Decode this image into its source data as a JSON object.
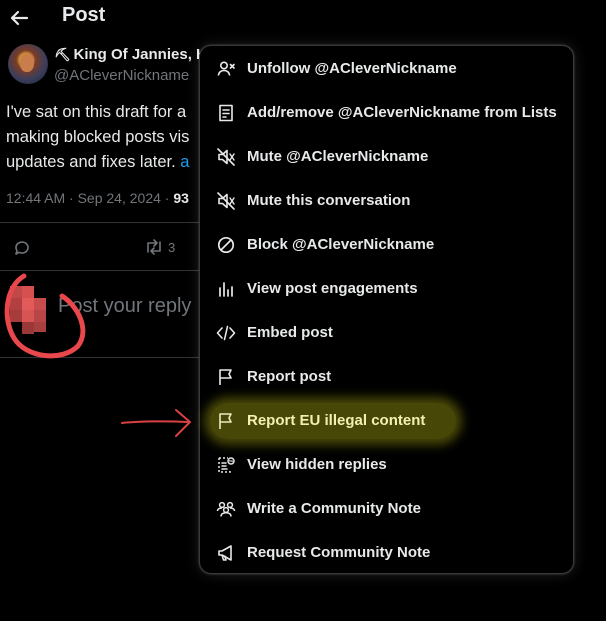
{
  "header": {
    "title": "Post",
    "back_icon": "arrow-left-icon"
  },
  "post": {
    "author_name": "King Of Jannies, H",
    "author_handle": "@ACleverNickname",
    "text_lines": [
      "I've sat on this draft for a",
      "making blocked posts vis",
      "updates and fixes later. "
    ],
    "text_link": "a",
    "timestamp": "12:44 AM · Sep 24, 2024 · ",
    "views": "93",
    "repost_count": "3"
  },
  "reply_box": {
    "placeholder": "Post your reply"
  },
  "menu": {
    "items": [
      {
        "label": "Unfollow @ACleverNickname",
        "icon": "unfollow-icon"
      },
      {
        "label": "Add/remove @ACleverNickname from Lists",
        "icon": "list-icon"
      },
      {
        "label": "Mute @ACleverNickname",
        "icon": "mute-icon"
      },
      {
        "label": "Mute this conversation",
        "icon": "mute-conversation-icon"
      },
      {
        "label": "Block @ACleverNickname",
        "icon": "block-icon"
      },
      {
        "label": "View post engagements",
        "icon": "engagements-icon"
      },
      {
        "label": "Embed post",
        "icon": "embed-icon"
      },
      {
        "label": "Report post",
        "icon": "flag-icon"
      },
      {
        "label": "Report EU illegal content",
        "icon": "flag-icon",
        "highlighted": true
      },
      {
        "label": "View hidden replies",
        "icon": "hidden-replies-icon"
      },
      {
        "label": "Write a Community Note",
        "icon": "community-icon"
      },
      {
        "label": "Request Community Note",
        "icon": "megaphone-icon"
      }
    ]
  },
  "colors": {
    "background": "#000000",
    "text": "#e7e9ea",
    "muted": "#71767b",
    "link": "#1d9bf0",
    "highlight": "#ffff1e",
    "annotation": "#e8474c"
  }
}
